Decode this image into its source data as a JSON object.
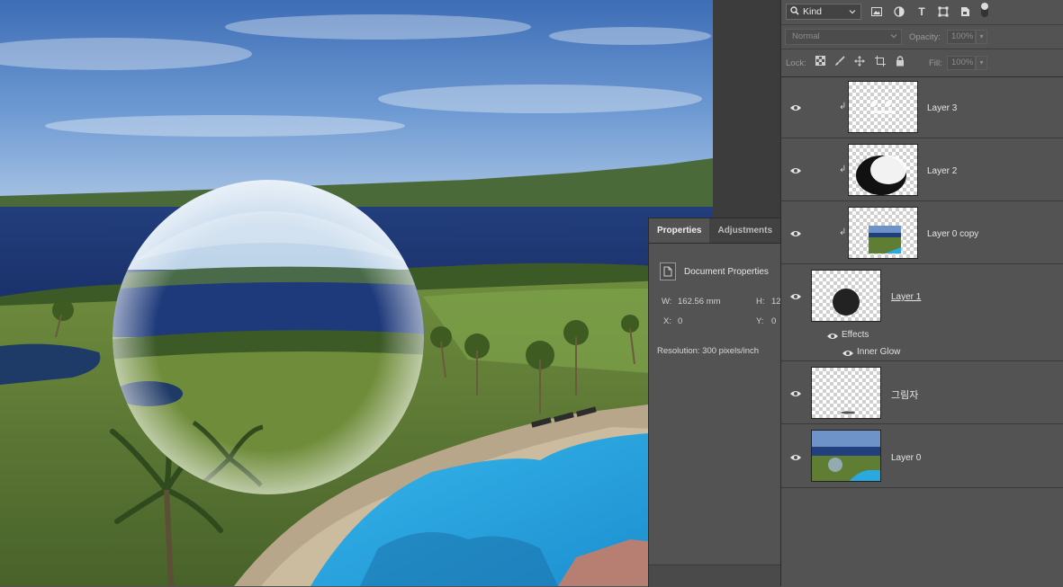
{
  "properties": {
    "tabs": [
      "Properties",
      "Adjustments"
    ],
    "document_label": "Document Properties",
    "width_label": "W:",
    "width_value": "162.56 mm",
    "height_label": "H:",
    "height_value": "12",
    "x_label": "X:",
    "x_value": "0",
    "y_label": "Y:",
    "y_value": "0",
    "resolution": "Resolution: 300 pixels/inch"
  },
  "layers_panel": {
    "filter_kind": "Kind",
    "filter_icons": [
      "image-filter-icon",
      "adjustment-filter-icon",
      "type-filter-icon",
      "shape-filter-icon",
      "smart-object-filter-icon"
    ],
    "blend_mode": "Normal",
    "opacity_label": "Opacity:",
    "opacity_value": "100%",
    "lock_label": "Lock:",
    "lock_icons": [
      "lock-transparent-icon",
      "lock-image-icon",
      "lock-position-icon",
      "lock-artboard-icon",
      "lock-all-icon"
    ],
    "fill_label": "Fill:",
    "fill_value": "100%",
    "layers": [
      {
        "name": "Layer 3",
        "clipped": true,
        "visible": true
      },
      {
        "name": "Layer 2",
        "clipped": true,
        "visible": true
      },
      {
        "name": "Layer 0 copy",
        "clipped": true,
        "visible": true
      },
      {
        "name": "Layer 1",
        "clipped": false,
        "visible": true,
        "effects_label": "Effects",
        "effect": "Inner Glow"
      },
      {
        "name": "그림자",
        "clipped": false,
        "visible": true
      },
      {
        "name": "Layer 0",
        "clipped": false,
        "visible": true
      }
    ]
  },
  "colors": {
    "panel_bg": "#535353",
    "panel_dark": "#424242",
    "pool": "#2aa9e0",
    "sea": "#1f3a78"
  }
}
